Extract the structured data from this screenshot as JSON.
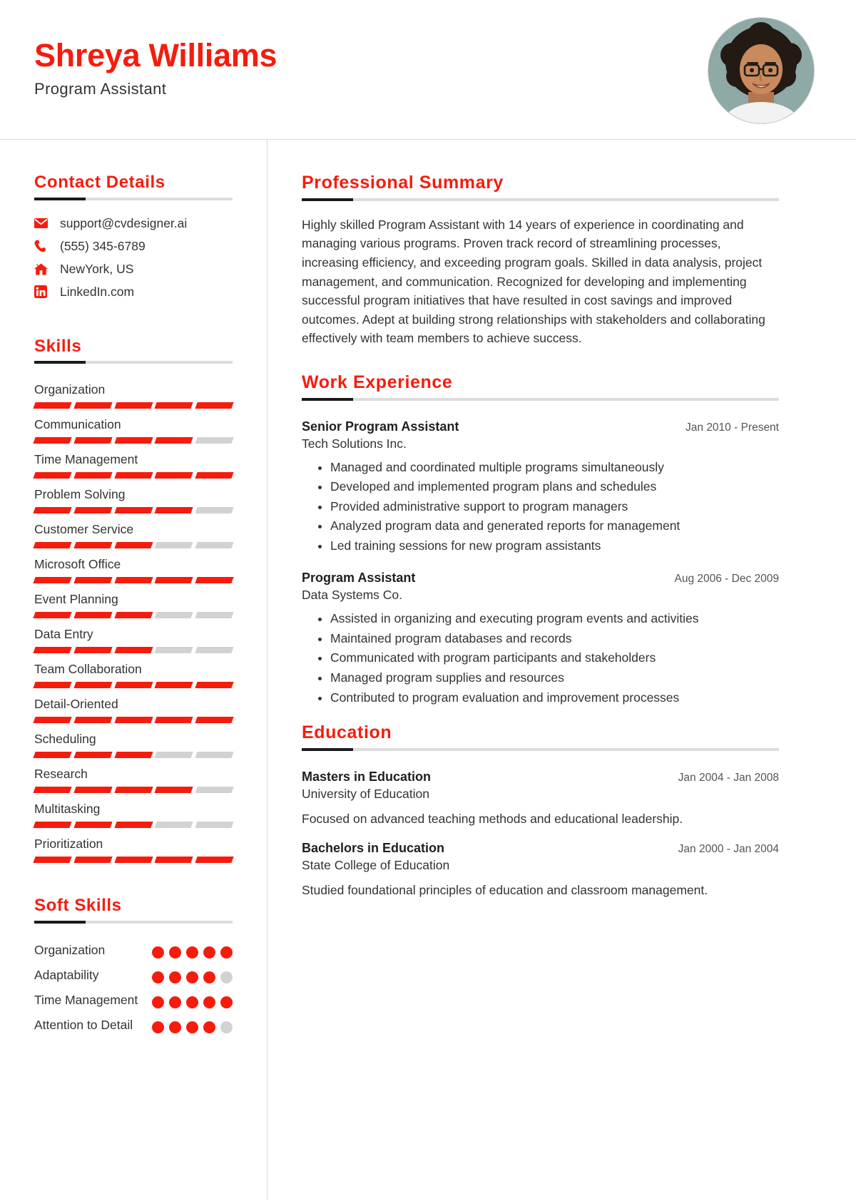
{
  "header": {
    "name": "Shreya Williams",
    "role": "Program Assistant",
    "photo_alt": "profile-photo",
    "accent_color": "#f61c0d"
  },
  "sidebar": {
    "contact": {
      "title": "Contact Details",
      "items": [
        {
          "icon": "email-icon",
          "value": "support@cvdesigner.ai"
        },
        {
          "icon": "phone-icon",
          "value": "(555) 345-6789"
        },
        {
          "icon": "home-icon",
          "value": "NewYork, US"
        },
        {
          "icon": "linkedin-icon",
          "value": "LinkedIn.com"
        }
      ]
    },
    "skills": {
      "title": "Skills",
      "max_level": 5,
      "items": [
        {
          "label": "Organization",
          "level": 5
        },
        {
          "label": "Communication",
          "level": 4
        },
        {
          "label": "Time Management",
          "level": 5
        },
        {
          "label": "Problem Solving",
          "level": 4
        },
        {
          "label": "Customer Service",
          "level": 3
        },
        {
          "label": "Microsoft Office",
          "level": 5
        },
        {
          "label": "Event Planning",
          "level": 3
        },
        {
          "label": "Data Entry",
          "level": 3
        },
        {
          "label": "Team Collaboration",
          "level": 5
        },
        {
          "label": "Detail-Oriented",
          "level": 5
        },
        {
          "label": "Scheduling",
          "level": 3
        },
        {
          "label": "Research",
          "level": 4
        },
        {
          "label": "Multitasking",
          "level": 3
        },
        {
          "label": "Prioritization",
          "level": 5
        }
      ]
    },
    "soft_skills": {
      "title": "Soft Skills",
      "max_level": 5,
      "items": [
        {
          "label": "Organization",
          "level": 5
        },
        {
          "label": "Adaptability",
          "level": 4
        },
        {
          "label": "Time Management",
          "level": 5
        },
        {
          "label": "Attention to Detail",
          "level": 4
        }
      ]
    }
  },
  "main": {
    "summary": {
      "title": "Professional Summary",
      "text": "Highly skilled Program Assistant with 14 years of experience in coordinating and managing various programs. Proven track record of streamlining processes, increasing efficiency, and exceeding program goals. Skilled in data analysis, project management, and communication. Recognized for developing and implementing successful program initiatives that have resulted in cost savings and improved outcomes. Adept at building strong relationships with stakeholders and collaborating effectively with team members to achieve success."
    },
    "experience": {
      "title": "Work Experience",
      "entries": [
        {
          "position": "Senior Program Assistant",
          "date": "Jan 2010 - Present",
          "company": "Tech Solutions Inc.",
          "bullets": [
            "Managed and coordinated multiple programs simultaneously",
            "Developed and implemented program plans and schedules",
            "Provided administrative support to program managers",
            "Analyzed program data and generated reports for management",
            "Led training sessions for new program assistants"
          ]
        },
        {
          "position": "Program Assistant",
          "date": "Aug 2006 - Dec 2009",
          "company": "Data Systems Co.",
          "bullets": [
            "Assisted in organizing and executing program events and activities",
            "Maintained program databases and records",
            "Communicated with program participants and stakeholders",
            "Managed program supplies and resources",
            "Contributed to program evaluation and improvement processes"
          ]
        }
      ]
    },
    "education": {
      "title": "Education",
      "entries": [
        {
          "degree": "Masters in Education",
          "date": "Jan 2004 - Jan 2008",
          "school": "University of Education",
          "description": "Focused on advanced teaching methods and educational leadership."
        },
        {
          "degree": "Bachelors in Education",
          "date": "Jan 2000 - Jan 2004",
          "school": "State College of Education",
          "description": "Studied foundational principles of education and classroom management."
        }
      ]
    }
  }
}
